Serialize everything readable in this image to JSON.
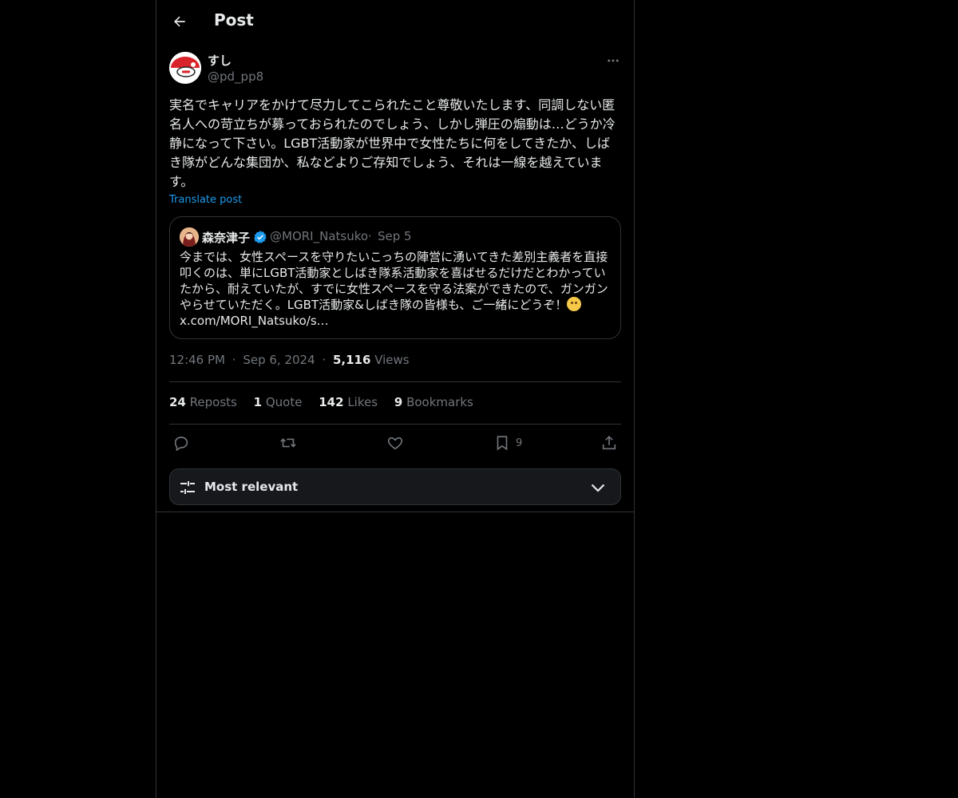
{
  "header": {
    "title": "Post",
    "back_icon": "arrow-left-icon"
  },
  "post": {
    "display_name": "すし",
    "handle": "@pd_pp8",
    "text": "実名でキャリアをかけて尽力してこられたこと尊敬いたします、同調しない匿名人への苛立ちが募っておられたのでしょう、しかし弾圧の煽動は…どうか冷静になって下さい。LGBT活動家が世界中で女性たちに何をしてきたか、しばき隊がどんな集団か、私などよりご存知でしょう、それは一線を越えています。",
    "translate_label": "Translate post",
    "time": "12:46 PM",
    "date": "Sep 6, 2024",
    "views_count": "5,116",
    "views_label": "Views",
    "separator": "·"
  },
  "quote": {
    "display_name": "森奈津子",
    "handle": "@MORI_Natsuko",
    "separator": "·",
    "date": "Sep 5",
    "text": "今までは、女性スペースを守りたいこっちの陣営に湧いてきた差別主義者を直接叩くのは、単にLGBT活動家としばき隊系活動家を喜ばせるだけだとわかっていたから、耐えていたが、すでに女性スペースを守る法案ができたので、ガンガンやらせていただく。LGBT活動家&しばき隊の皆様も、ご一緒にどうぞ！",
    "emoji": "smiling-face-emoji",
    "link": "x.com/MORI_Natsuko/s…"
  },
  "stats": {
    "reposts_count": "24",
    "reposts_label": "Reposts",
    "quotes_count": "1",
    "quotes_label": "Quote",
    "likes_count": "142",
    "likes_label": "Likes",
    "bookmarks_count": "9",
    "bookmarks_label": "Bookmarks"
  },
  "actions": {
    "reply_icon": "reply-icon",
    "repost_icon": "repost-icon",
    "like_icon": "heart-icon",
    "bookmark_icon": "bookmark-icon",
    "bookmark_count": "9",
    "share_icon": "share-icon"
  },
  "sort": {
    "label": "Most relevant",
    "icon": "sliders-icon",
    "chevron": "chevron-down-icon"
  },
  "colors": {
    "background": "#000000",
    "text": "#e7e9ea",
    "muted": "#71767b",
    "accent": "#1d9bf0",
    "border": "#2f3336"
  }
}
